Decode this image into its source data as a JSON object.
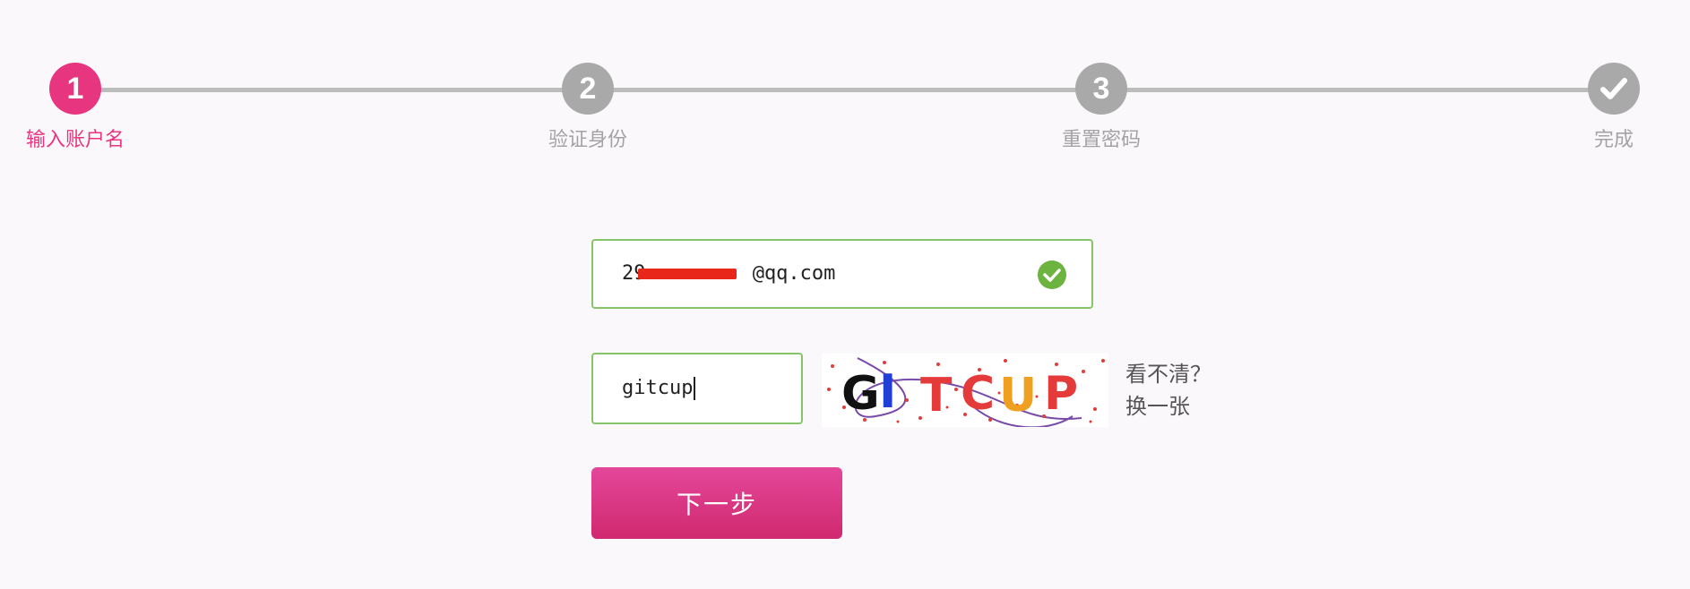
{
  "colors": {
    "accent": "#e8357f",
    "inactive_step": "#a9a9a9",
    "track": "#bcbcbc",
    "valid_border": "#86c46a",
    "valid_icon": "#6db33f",
    "button": "#d83680"
  },
  "steps": [
    {
      "number": "1",
      "label": "输入账户名",
      "state": "active"
    },
    {
      "number": "2",
      "label": "验证身份",
      "state": "pending"
    },
    {
      "number": "3",
      "label": "重置密码",
      "state": "pending"
    },
    {
      "number": "✔",
      "label": "完成",
      "state": "pending",
      "icon": "check-icon"
    }
  ],
  "form": {
    "account_value": "29         @qq.com",
    "account_valid_icon": "check-circle-icon",
    "captcha_value": "gitcup",
    "captcha_image_text": "GITCUP",
    "captcha_refresh_line1": "看不清？",
    "captcha_refresh_line2": "换一张",
    "next_button_label": "下一步"
  }
}
